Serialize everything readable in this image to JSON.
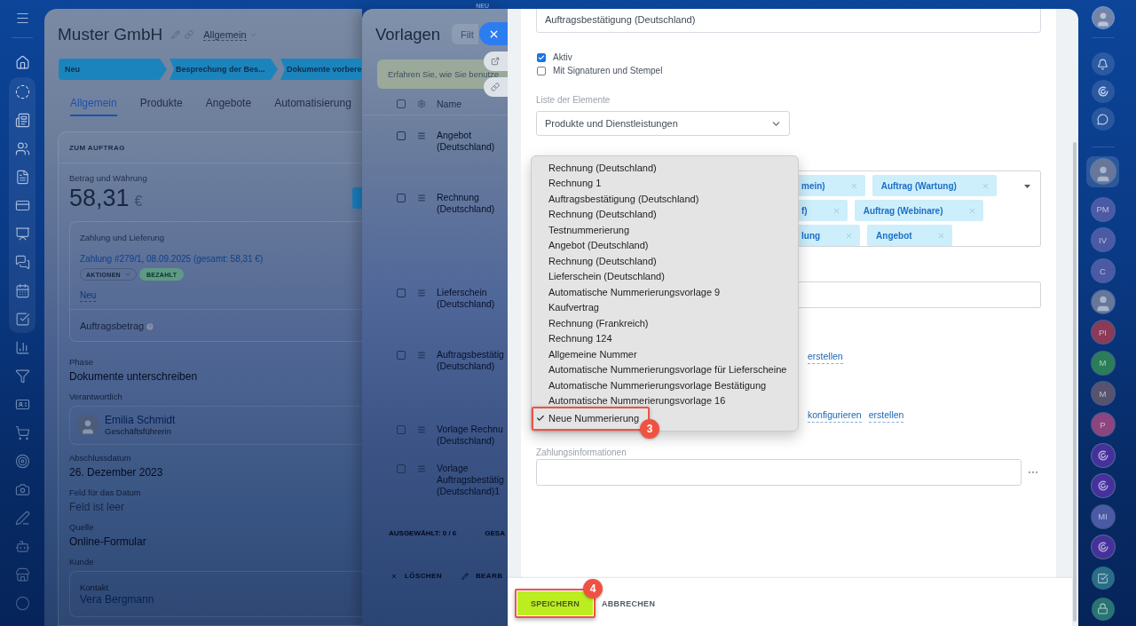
{
  "top_badge": "NEU",
  "deal": {
    "title": "Muster GmbH",
    "category": "Allgemein",
    "stages": [
      {
        "label": "Neu"
      },
      {
        "label": "Besprechung der Bes..."
      },
      {
        "label": "Dokumente vorbere"
      }
    ],
    "tabs": [
      {
        "label": "Allgemein",
        "selected": true
      },
      {
        "label": "Produkte",
        "selected": false
      },
      {
        "label": "Angebote",
        "selected": false
      },
      {
        "label": "Automatisierung",
        "selected": false
      }
    ],
    "order": {
      "title": "ZUM AUFTRAG",
      "amount_label": "Betrag und Währung",
      "amount": "58,31",
      "currency": "€",
      "payment_label": "Zahlung und Lieferung",
      "payment_link": "Zahlung #279/1, 08.09.2025 (gesamt: 58,31 €)",
      "actions": "AKTIONEN",
      "payment_status": "BEZAHLT",
      "new_link": "Neu",
      "total_label": "Auftragsbetrag"
    },
    "fields": [
      {
        "kind": "text",
        "label": "Phase",
        "value": "Dokumente unterschreiben"
      },
      {
        "kind": "person",
        "label": "Verantwortlich",
        "name": "Emilia Schmidt",
        "role": "Geschäftsführerin"
      },
      {
        "kind": "text",
        "label": "Abschlussdatum",
        "value": "26. Dezember 2023"
      },
      {
        "kind": "empty",
        "label": "Feld für das Datum",
        "value": "Feld ist leer"
      },
      {
        "kind": "text",
        "label": "Quelle",
        "value": "Online-Formular"
      },
      {
        "kind": "contact",
        "label": "Kunde",
        "caption": "Kontakt",
        "name": "Vera Bergmann"
      }
    ]
  },
  "templates": {
    "title": "Vorlagen",
    "search": {
      "placeholder": "Filt"
    },
    "banner": "Erfahren Sie, wie Sie benutze",
    "header": {
      "checked": false,
      "column": "Name"
    },
    "rows": [
      {
        "name": "Angebot (Deutschland)",
        "checked": false
      },
      {
        "name": "Rechnung (Deutschland)",
        "checked": false
      },
      {
        "name": "Lieferschein (Deutschland)",
        "checked": false
      },
      {
        "name": "Auftragsbestätig (Deutschland)",
        "checked": false
      },
      {
        "name": "Vorlage Rechnu (Deutschland)",
        "checked": false
      },
      {
        "name": "Vorlage Auftragsbestätig (Deutschland)1",
        "checked": false
      }
    ],
    "footer": {
      "selected": "AUSGEWÄHLT: 0 / 6",
      "total": "GESA"
    },
    "actions": [
      {
        "kind": "delete",
        "label": "LÖSCHEN"
      },
      {
        "kind": "edit",
        "label": "BEARB"
      }
    ]
  },
  "form": {
    "name": {
      "value": "Auftragsbestätigung (Deutschland)"
    },
    "options": [
      {
        "label": "Aktiv",
        "checked": true
      },
      {
        "label": "Mit Signaturen und Stempel",
        "checked": false
      }
    ],
    "items_list": {
      "label": "Liste der Elemente",
      "value": "Produkte und Dienstleistungen"
    },
    "numbering_menu": [
      {
        "label": "Rechnung (Deutschland)",
        "selected": false,
        "highlighted": false
      },
      {
        "label": "Rechnung 1",
        "selected": false,
        "highlighted": false
      },
      {
        "label": "Auftragsbestätigung (Deutschland)",
        "selected": false,
        "highlighted": false
      },
      {
        "label": "Rechnung (Deutschland)",
        "selected": false,
        "highlighted": false
      },
      {
        "label": "Testnummerierung",
        "selected": false,
        "highlighted": false
      },
      {
        "label": "Angebot (Deutschland)",
        "selected": false,
        "highlighted": false
      },
      {
        "label": "Rechnung (Deutschland)",
        "selected": false,
        "highlighted": false
      },
      {
        "label": "Lieferschein (Deutschland)",
        "selected": false,
        "highlighted": false
      },
      {
        "label": "Automatische Nummerierungsvorlage 9",
        "selected": false,
        "highlighted": false
      },
      {
        "label": "Kaufvertrag",
        "selected": false,
        "highlighted": false
      },
      {
        "label": "Rechnung (Frankreich)",
        "selected": false,
        "highlighted": false
      },
      {
        "label": "Rechnung 124",
        "selected": false,
        "highlighted": false
      },
      {
        "label": "Allgemeine Nummer",
        "selected": false,
        "highlighted": false
      },
      {
        "label": "Automatische Nummerierungsvorlage für Lieferscheine",
        "selected": false,
        "highlighted": false
      },
      {
        "label": "Automatische Nummerierungsvorlage Bestätigung",
        "selected": false,
        "highlighted": false
      },
      {
        "label": "Automatische Nummerierungsvorlage 16",
        "selected": false,
        "highlighted": false
      },
      {
        "label": "Neue Nummerierung",
        "selected": true,
        "highlighted": true,
        "marker": "3"
      }
    ],
    "tag_rows": [
      [
        {
          "label": "mein)"
        },
        {
          "label": "Auftrag (Wartung)"
        }
      ],
      [
        {
          "label": "f)"
        },
        {
          "label": "Auftrag (Webinare)"
        }
      ],
      [
        {
          "label": "lung"
        },
        {
          "label": "Angebot"
        }
      ]
    ],
    "link_rows": [
      [
        {
          "label": "erstellen"
        }
      ],
      [
        {
          "label": "konfigurieren"
        },
        {
          "label": "erstellen"
        }
      ]
    ],
    "payment_info": {
      "label": "Zahlungsinformationen"
    },
    "buttons": [
      {
        "label": "SPEICHERN",
        "kind": "primary",
        "highlighted": true,
        "marker": "4"
      },
      {
        "label": "ABBRECHEN",
        "kind": "plain",
        "highlighted": false
      }
    ]
  },
  "right_bar": {
    "contacts": [
      {
        "kind": "photo",
        "selected": true
      },
      {
        "kind": "initials",
        "text": "PM",
        "color": "#4c5aa6",
        "selected": false
      },
      {
        "kind": "initials",
        "text": "IV",
        "color": "#4c5aa6",
        "selected": false
      },
      {
        "kind": "initials",
        "text": "C",
        "color": "#4c5aa6",
        "selected": false
      },
      {
        "kind": "photo",
        "selected": false
      },
      {
        "kind": "initials",
        "text": "PI",
        "color": "#8b3a57",
        "selected": false
      },
      {
        "kind": "initials",
        "text": "M",
        "color": "#2b7d58",
        "selected": false
      },
      {
        "kind": "initials",
        "text": "M",
        "color": "#57536f",
        "selected": false
      },
      {
        "kind": "initials",
        "text": "P",
        "color": "#8d4580",
        "selected": false
      },
      {
        "kind": "channel",
        "color": "#46319c",
        "selected": false
      },
      {
        "kind": "channel",
        "color": "#46319c",
        "selected": false
      },
      {
        "kind": "initials",
        "text": "MI",
        "color": "#4c5aa6",
        "selected": false
      },
      {
        "kind": "channel",
        "color": "#46319c",
        "selected": false
      },
      {
        "kind": "tasks",
        "color": "#2a6d87",
        "selected": false
      },
      {
        "kind": "lock",
        "color": "#2a7373",
        "selected": false
      }
    ]
  }
}
